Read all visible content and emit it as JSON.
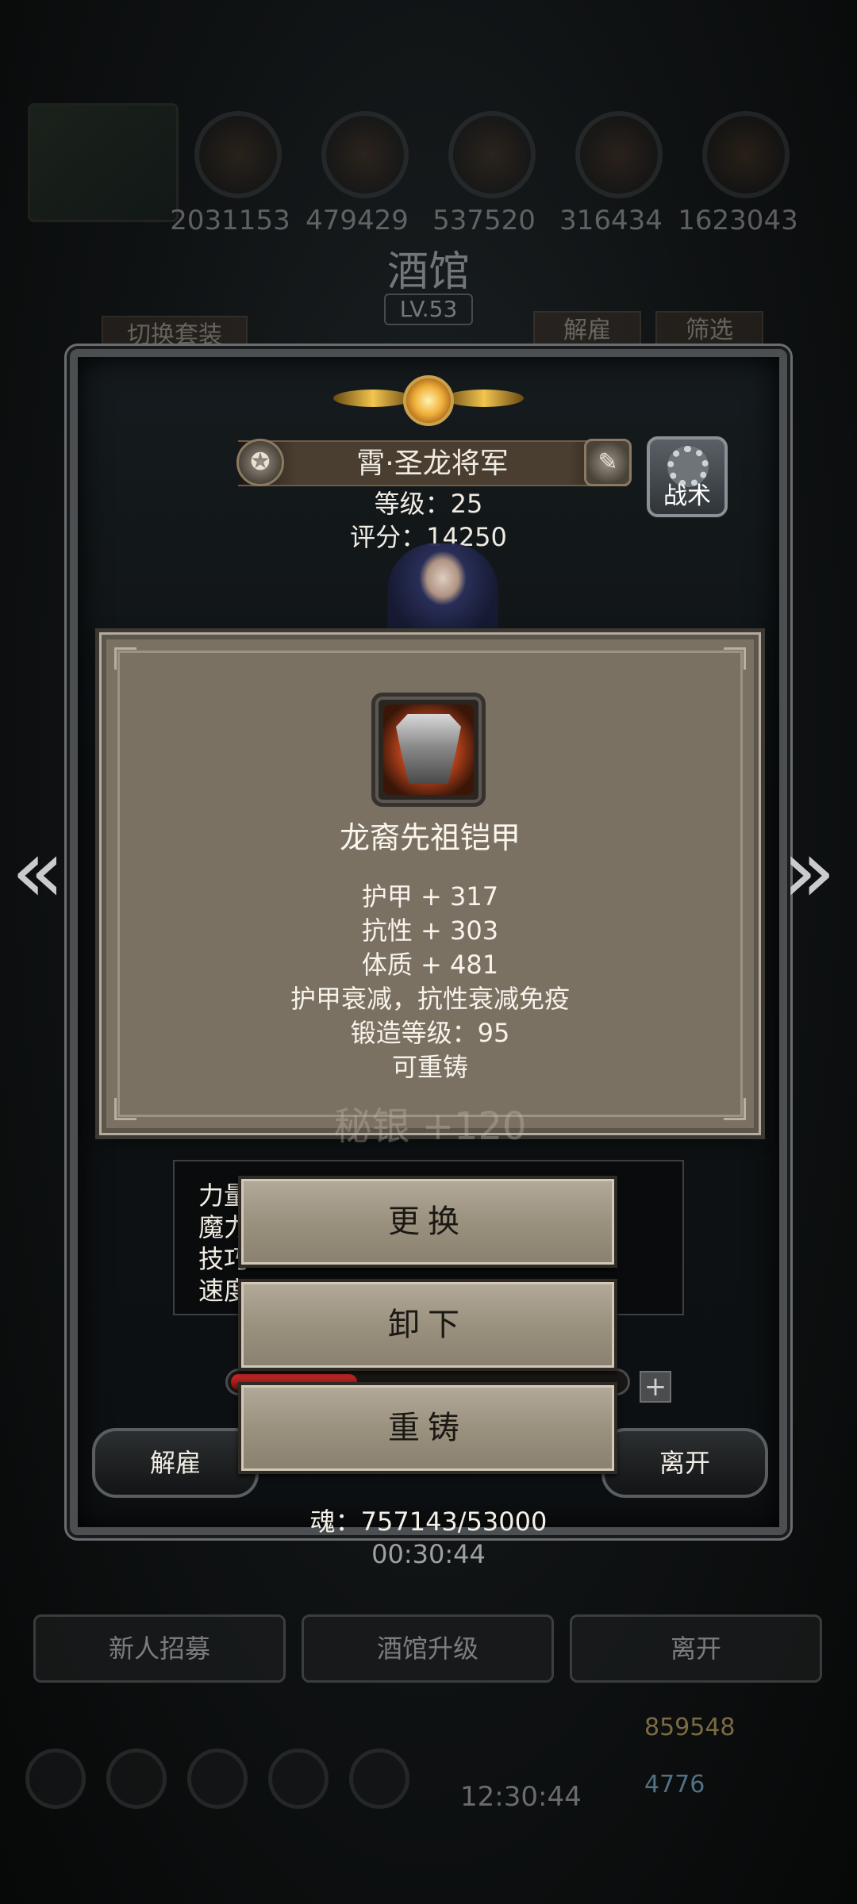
{
  "background": {
    "resources": [
      "2031153",
      "479429",
      "537520",
      "316434",
      "1623043"
    ],
    "tavern_title": "酒馆",
    "tavern_level": "LV.53",
    "switch_outfit": "切换套装",
    "dismiss": "解雇",
    "filter": "筛选",
    "bottom_buttons": [
      "新人招募",
      "酒馆升级",
      "离开"
    ],
    "gold": "859548",
    "gems": "4776",
    "clock": "12:30:44"
  },
  "hero": {
    "name": "霄·圣龙将军",
    "level_line": "等级：25",
    "score_line": "评分：14250",
    "tactic_label": "战术"
  },
  "item": {
    "name": "龙裔先祖铠甲",
    "lines": [
      "护甲 + 317",
      "抗性 + 303",
      "体质 + 481",
      "护甲衰减，抗性衰减免疫",
      "锻造等级：95",
      "可重铸"
    ],
    "ghost_line": "秘银 +120",
    "icon": "armor-icon"
  },
  "attributes": {
    "labels": [
      "力量",
      "魔力",
      "技巧",
      "速度"
    ]
  },
  "actions": {
    "replace": "更换",
    "unequip": "卸下",
    "reforge": "重铸"
  },
  "dialog": {
    "dismiss_label": "解雇",
    "leave_label": "离开",
    "soul": "魂：757143/53000",
    "timer": "00:30:44",
    "hp_fraction": 0.32
  },
  "colors": {
    "tooltip_bg": "#7b7163",
    "action_bg": "#9b917f",
    "hp_red": "#d12a2a"
  }
}
